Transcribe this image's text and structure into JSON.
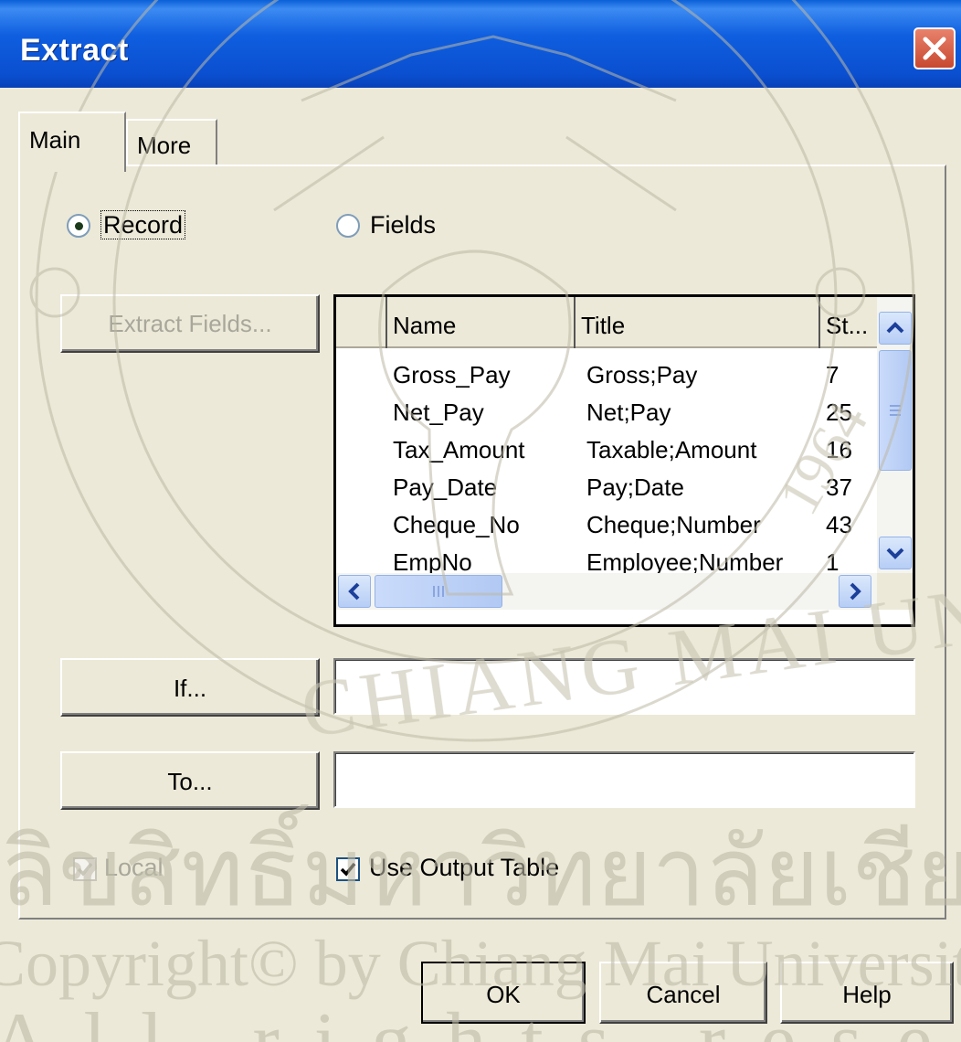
{
  "window": {
    "title": "Extract"
  },
  "tabs": [
    {
      "label": "Main",
      "active": true
    },
    {
      "label": "More",
      "active": false
    }
  ],
  "mode": {
    "record_label": "Record",
    "fields_label": "Fields",
    "selected": "Record"
  },
  "buttons": {
    "extract_fields": "Extract Fields...",
    "if": "If...",
    "to": "To...",
    "ok": "OK",
    "cancel": "Cancel",
    "help": "Help"
  },
  "fields_grid": {
    "columns": [
      "Name",
      "Title",
      "St..."
    ],
    "rows": [
      {
        "name": "Gross_Pay",
        "title": "Gross;Pay",
        "start": "7"
      },
      {
        "name": "Net_Pay",
        "title": "Net;Pay",
        "start": "25"
      },
      {
        "name": "Tax_Amount",
        "title": "Taxable;Amount",
        "start": "16"
      },
      {
        "name": "Pay_Date",
        "title": "Pay;Date",
        "start": "37"
      },
      {
        "name": "Cheque_No",
        "title": "Cheque;Number",
        "start": "43"
      },
      {
        "name": "EmpNo",
        "title": "Employee;Number",
        "start": "1"
      }
    ]
  },
  "inputs": {
    "if_value": "",
    "to_value": ""
  },
  "checkboxes": {
    "local_label": "Local",
    "local_checked": true,
    "local_enabled": false,
    "use_output_label": "Use Output Table",
    "use_output_checked": true
  },
  "watermark": {
    "text_thai": "ลิขสิทธิ์มหาวิทยาลัยเชียงใหม่",
    "text_copyright": "Copyright© by Chiang Mai University",
    "text_rights": "All rights reserved",
    "seal_text": "CHIANG MAI UNIVERSITY",
    "seal_year": "1964"
  },
  "colors": {
    "titlebar": "#0a4fd0",
    "dialog_bg": "#ece9d8",
    "close_button": "#c8482f"
  }
}
